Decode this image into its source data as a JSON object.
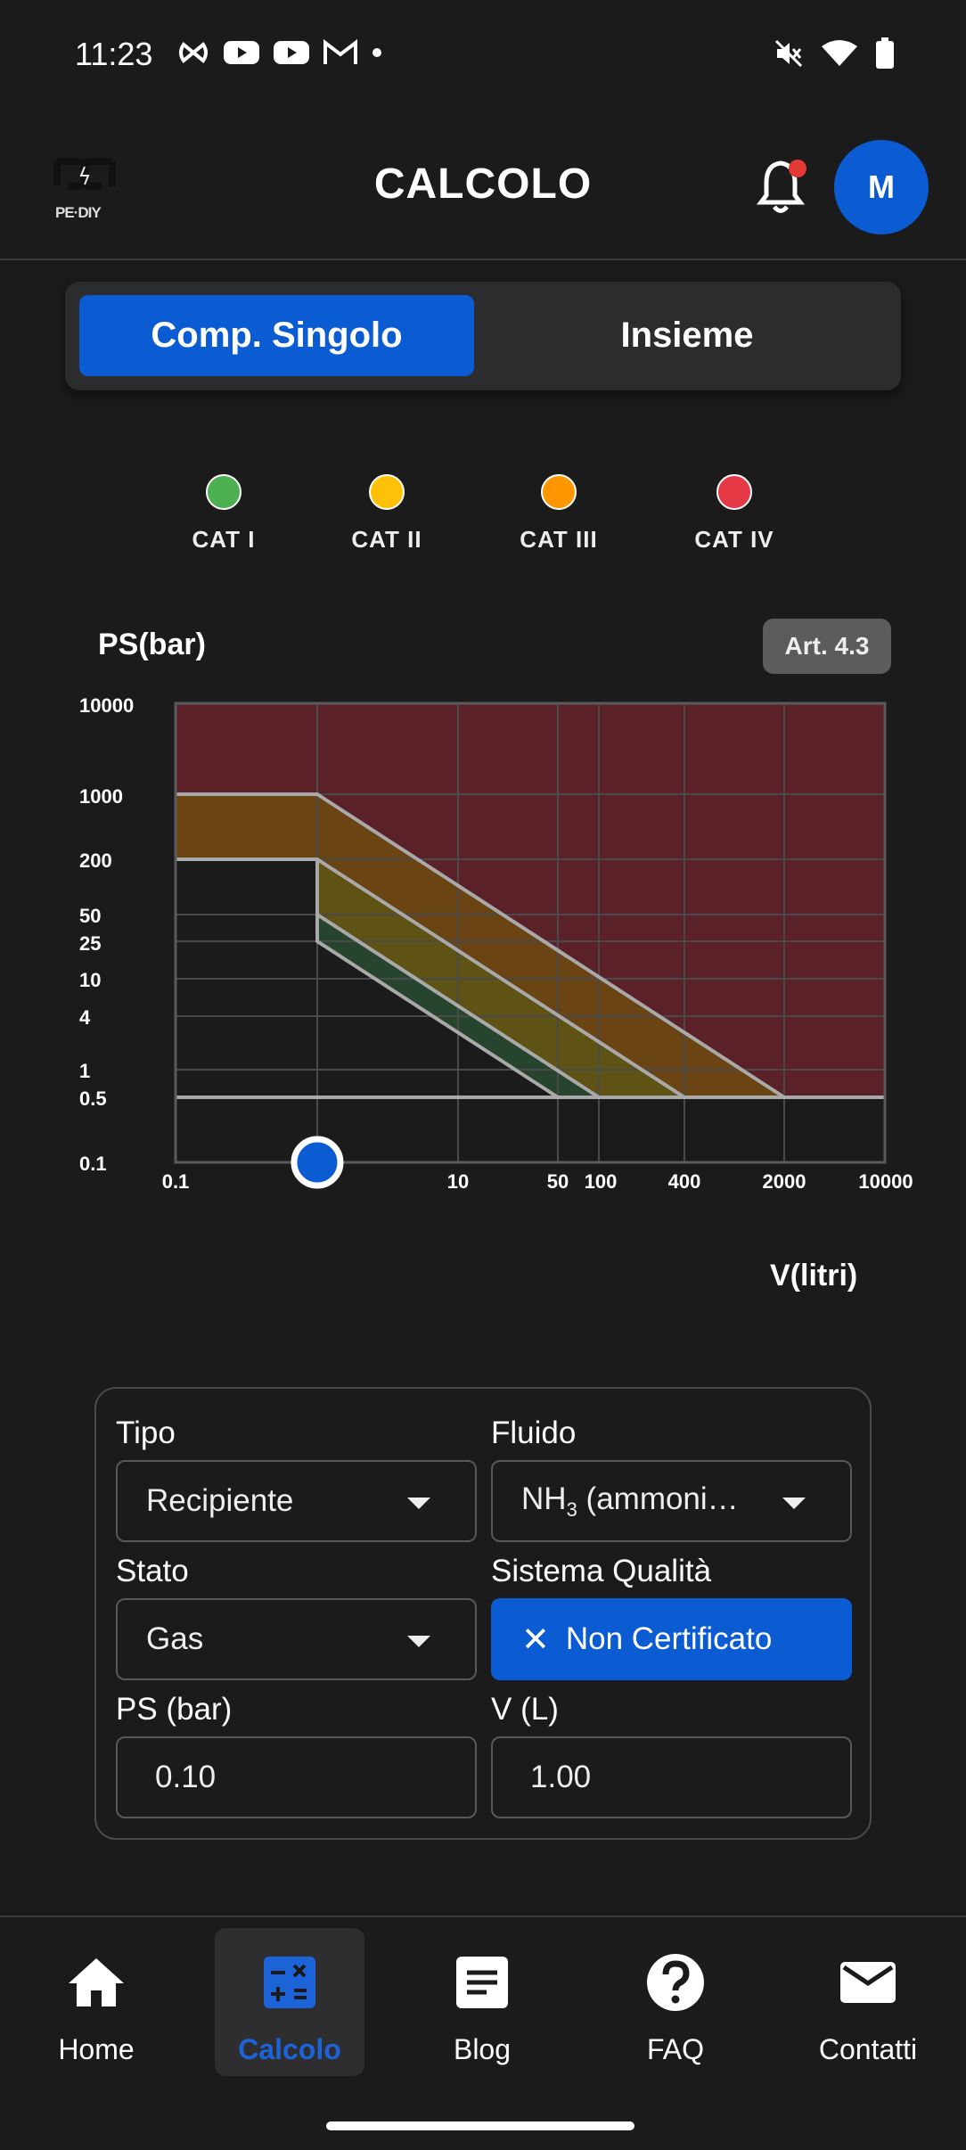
{
  "status_bar": {
    "time": "11:23",
    "icons": [
      "pairing-icon",
      "youtube-icon",
      "youtube-icon",
      "gmail-icon",
      "dot-icon"
    ],
    "right_icons": [
      "mute-icon",
      "wifi-icon",
      "battery-icon"
    ]
  },
  "app_bar": {
    "logo_text": "PE·DIY",
    "title": "CALCOLO",
    "avatar_initial": "M",
    "notification_dot_color": "#e53935"
  },
  "segment": {
    "options": [
      "Comp. Singolo",
      "Insieme"
    ],
    "selected": "Comp. Singolo"
  },
  "legend": [
    {
      "label": "CAT I",
      "color": "#4caf50"
    },
    {
      "label": "CAT II",
      "color": "#ffc107"
    },
    {
      "label": "CAT III",
      "color": "#ff9800"
    },
    {
      "label": "CAT IV",
      "color": "#e53946"
    }
  ],
  "chart": {
    "ylabel": "PS(bar)",
    "xlabel": "V(litri)",
    "badge": "Art. 4.3"
  },
  "chart_data": {
    "type": "area",
    "x_scale": "log",
    "y_scale": "log",
    "x_ticks": [
      "0.1",
      "10",
      "50",
      "100",
      "400",
      "2000",
      "10000"
    ],
    "y_ticks": [
      "10000",
      "1000",
      "200",
      "50",
      "25",
      "10",
      "4",
      "1",
      "0.5",
      "0.1"
    ],
    "xlim": [
      0.1,
      10000
    ],
    "ylim": [
      0.1,
      10000
    ],
    "regions": [
      {
        "name": "CAT IV",
        "color": "#5a2228"
      },
      {
        "name": "CAT III",
        "color": "#6b4414"
      },
      {
        "name": "CAT II",
        "color": "#5e5314"
      },
      {
        "name": "CAT I",
        "color": "#27452e"
      }
    ],
    "current_point": {
      "x": 1,
      "y": 0.1,
      "color": "#0b5bd3"
    }
  },
  "form": {
    "tipo_label": "Tipo",
    "tipo_value": "Recipiente",
    "fluido_label": "Fluido",
    "fluido_prefix": "NH",
    "fluido_sub": "3",
    "fluido_suffix": " (ammoni…",
    "stato_label": "Stato",
    "stato_value": "Gas",
    "qualita_label": "Sistema Qualità",
    "qualita_value": "Non Certificato",
    "ps_label": "PS (bar)",
    "ps_value": "0.10",
    "v_label": "V (L)",
    "v_value": "1.00"
  },
  "bottom_nav": [
    {
      "label": "Home",
      "icon": "home-icon"
    },
    {
      "label": "Calcolo",
      "icon": "calculator-icon",
      "active": true
    },
    {
      "label": "Blog",
      "icon": "article-icon"
    },
    {
      "label": "FAQ",
      "icon": "help-icon"
    },
    {
      "label": "Contatti",
      "icon": "mail-icon"
    }
  ]
}
